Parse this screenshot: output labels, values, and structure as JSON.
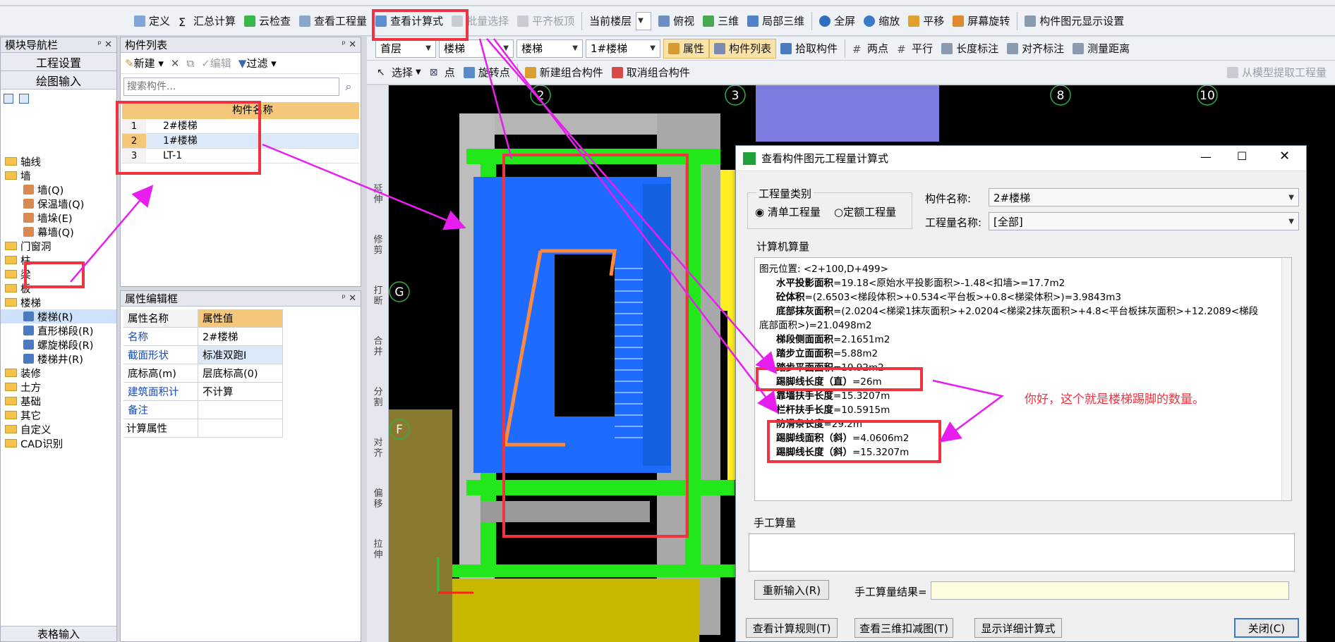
{
  "toolbar1": {
    "define": "定义",
    "summary_calc": "汇总计算",
    "cloud_check": "云检查",
    "view_project": "查看工程量",
    "view_formula": "查看计算式",
    "batch_select": "批量选择",
    "align_top": "平齐板顶",
    "current_floor": "当前楼层",
    "view_mode": "俯视",
    "three_d": "三维",
    "partial_3d": "局部三维",
    "fullscreen": "全屏",
    "zoom": "缩放",
    "pan": "平移",
    "screen_rotate": "屏幕旋转",
    "element_display": "构件图元显示设置"
  },
  "toolbar2": {
    "floor": "首层",
    "category": "楼梯",
    "type": "楼梯",
    "element": "1#楼梯",
    "properties": "属性",
    "element_list": "构件列表",
    "pick_element": "拾取构件",
    "two_points": "两点",
    "parallel": "平行",
    "length_dim": "长度标注",
    "align_dim": "对齐标注",
    "measure": "测量距离"
  },
  "toolbar3": {
    "select": "选择",
    "point": "点",
    "rotate_point": "旋转点",
    "new_group": "新建组合构件",
    "cancel_group": "取消组合构件",
    "extract": "从模型提取工程量"
  },
  "nav": {
    "title": "模块导航栏",
    "project_settings": "工程设置",
    "drawing_input": "绘图输入",
    "table_input": "表格输入",
    "tree": [
      {
        "label": "轴线",
        "level": 0,
        "type": "folder"
      },
      {
        "label": "墙",
        "level": 0,
        "type": "folder"
      },
      {
        "label": "墙(Q)",
        "level": 1,
        "type": "wall"
      },
      {
        "label": "保温墙(Q)",
        "level": 1,
        "type": "wall"
      },
      {
        "label": "墙垛(E)",
        "level": 1,
        "type": "wall"
      },
      {
        "label": "幕墙(Q)",
        "level": 1,
        "type": "wall"
      },
      {
        "label": "门窗洞",
        "level": 0,
        "type": "folder"
      },
      {
        "label": "柱",
        "level": 0,
        "type": "folder"
      },
      {
        "label": "梁",
        "level": 0,
        "type": "folder"
      },
      {
        "label": "板",
        "level": 0,
        "type": "folder"
      },
      {
        "label": "楼梯",
        "level": 0,
        "type": "folder"
      },
      {
        "label": "楼梯(R)",
        "level": 1,
        "type": "stair"
      },
      {
        "label": "直形梯段(R)",
        "level": 1,
        "type": "stair"
      },
      {
        "label": "螺旋梯段(R)",
        "level": 1,
        "type": "stair"
      },
      {
        "label": "楼梯井(R)",
        "level": 1,
        "type": "stair"
      },
      {
        "label": "装修",
        "level": 0,
        "type": "folder"
      },
      {
        "label": "土方",
        "level": 0,
        "type": "folder"
      },
      {
        "label": "基础",
        "level": 0,
        "type": "folder"
      },
      {
        "label": "其它",
        "level": 0,
        "type": "folder"
      },
      {
        "label": "自定义",
        "level": 0,
        "type": "folder"
      },
      {
        "label": "CAD识别",
        "level": 0,
        "type": "folder"
      }
    ]
  },
  "elements_panel": {
    "title": "构件列表",
    "new": "新建",
    "edit": "编辑",
    "filter": "过滤",
    "search_placeholder": "搜索构件...",
    "col_header": "构件名称",
    "rows": [
      {
        "num": "1",
        "name": "2#楼梯"
      },
      {
        "num": "2",
        "name": "1#楼梯"
      },
      {
        "num": "3",
        "name": "LT-1"
      }
    ]
  },
  "props_panel": {
    "title": "属性编辑框",
    "col_name": "属性名称",
    "col_value": "属性值",
    "rows": [
      {
        "name": "名称",
        "value": "2#楼梯"
      },
      {
        "name": "截面形状",
        "value": "标准双跑I"
      },
      {
        "name": "底标高(m)",
        "value": "层底标高(0)"
      },
      {
        "name": "建筑面积计",
        "value": "不计算"
      },
      {
        "name": "备注",
        "value": ""
      },
      {
        "name": "计算属性",
        "value": ""
      }
    ]
  },
  "side_tools": [
    "延伸",
    "修剪",
    "打断",
    "合并",
    "分割",
    "对齐",
    "偏移",
    "拉伸"
  ],
  "axis_labels": {
    "top": [
      "2",
      "3",
      "8",
      "10"
    ],
    "left": [
      "G",
      "F"
    ]
  },
  "dialog": {
    "title": "查看构件图元工程量计算式",
    "qty_type_label": "工程量类别",
    "radio_bill": "清单工程量",
    "radio_quota": "定额工程量",
    "element_name_label": "构件名称:",
    "element_name_value": "2#楼梯",
    "qty_name_label": "工程量名称:",
    "qty_name_value": "[全部]",
    "computer_qty_label": "计算机算量",
    "lines": [
      {
        "b": "",
        "t": "图元位置: <2+100,D+499>"
      },
      {
        "b": "水平投影面积",
        "t": "=19.18<原始水平投影面积>-1.48<扣墙>=17.7m2"
      },
      {
        "b": "砼体积",
        "t": "=(2.6503<梯段体积>+0.534<平台板>+0.8<梯梁体积>)=3.9843m3"
      },
      {
        "b": "底部抹灰面积",
        "t": "=(2.0204<梯梁1抹灰面积>+2.0204<梯梁2抹灰面积>+4.8<平台板抹灰面积>+12.2089<梯段"
      },
      {
        "b": "",
        "t": "底部面积>)=21.0498m2"
      },
      {
        "b": "梯段侧面面积",
        "t": "=2.1651m2"
      },
      {
        "b": "踏步立面面积",
        "t": "=5.88m2"
      },
      {
        "b": "踏步平面面积",
        "t": "=10.92m2"
      },
      {
        "b": "踢脚线长度（直）",
        "t": "=26m"
      },
      {
        "b": "靠墙扶手长度",
        "t": "=15.3207m"
      },
      {
        "b": "栏杆扶手长度",
        "t": "=10.5915m"
      },
      {
        "b": "防滑条长度",
        "t": "=29.2m"
      },
      {
        "b": "踢脚线面积（斜）",
        "t": "=4.0606m2"
      },
      {
        "b": "踢脚线长度（斜）",
        "t": "=15.3207m"
      }
    ],
    "annotation": "你好，这个就是楼梯踢脚的数量。",
    "manual_label": "手工算量",
    "reinput": "重新输入(R)",
    "manual_result_label": "手工算量结果=",
    "btn_rules": "查看计算规则(T)",
    "btn_3d": "查看三维扣减图(T)",
    "btn_detail": "显示详细计算式",
    "btn_close": "关闭(C)"
  },
  "colors": {
    "highlight": "#ef3340",
    "arrow": "#e81ef0",
    "stair_blue": "#1e6cff",
    "beam_green": "#22e81b",
    "wall_gray": "#b5b5b5"
  }
}
